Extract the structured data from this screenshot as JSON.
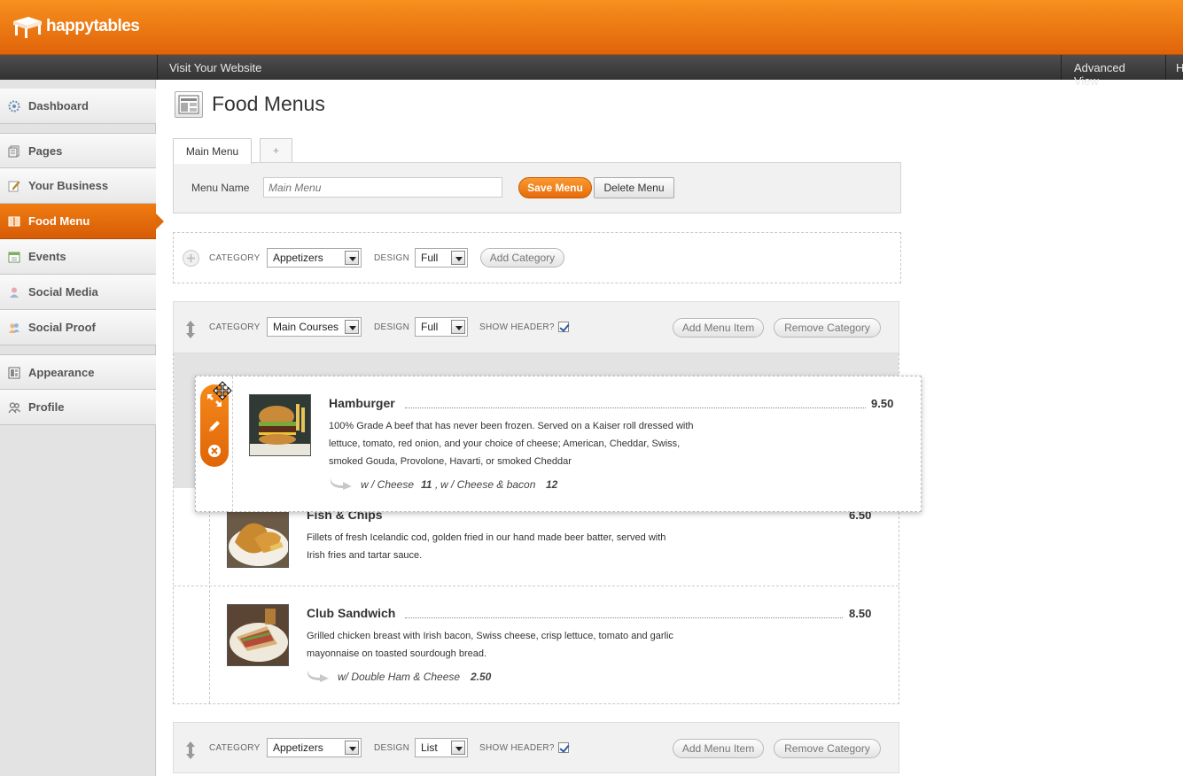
{
  "brand": {
    "name": "happytables"
  },
  "topnav": {
    "visit_site": "Visit Your Website",
    "advanced_view": "Advanced View",
    "help_partial": "H"
  },
  "sidebar": {
    "items": [
      {
        "label": "Dashboard",
        "icon": "dashboard-icon"
      },
      {
        "label": "Pages",
        "icon": "pages-icon"
      },
      {
        "label": "Your Business",
        "icon": "pencil-icon"
      },
      {
        "label": "Food Menu",
        "icon": "book-icon",
        "active": true
      },
      {
        "label": "Events",
        "icon": "calendar-icon"
      },
      {
        "label": "Social Media",
        "icon": "person-icon"
      },
      {
        "label": "Social Proof",
        "icon": "people-icon"
      },
      {
        "label": "Appearance",
        "icon": "layout-icon"
      },
      {
        "label": "Profile",
        "icon": "users-icon"
      }
    ]
  },
  "page": {
    "title": "Food Menus"
  },
  "tabs": {
    "main": "Main Menu",
    "add": "+"
  },
  "menu_form": {
    "name_label": "Menu Name",
    "name_placeholder": "Main Menu",
    "save_label": "Save Menu",
    "delete_label": "Delete Menu"
  },
  "new_category": {
    "category_label": "CATEGORY",
    "category_value": "Appetizers",
    "design_label": "DESIGN",
    "design_value": "Full",
    "add_label": "Add Category"
  },
  "categories": [
    {
      "category_label": "CATEGORY",
      "category_value": "Main Courses",
      "design_label": "DESIGN",
      "design_value": "Full",
      "show_header_label": "SHOW HEADER?",
      "show_header": true,
      "add_item_label": "Add Menu Item",
      "remove_label": "Remove Category",
      "items": [
        {
          "title": "Hamburger",
          "price": "9.50",
          "desc_lines": [
            "100% Grade A beef that has never been frozen. Served on a Kaiser roll dressed with",
            "lettuce, tomato, red onion, and your choice of cheese; American, Cheddar, Swiss,",
            "smoked Gouda, Provolone, Havarti, or smoked Cheddar"
          ],
          "addons": [
            {
              "label": "w / Cheese",
              "price": "11"
            },
            {
              "label": "w / Cheese & bacon",
              "price": "12"
            }
          ],
          "addon_sep": ","
        },
        {
          "title": "Fish & Chips",
          "price": "6.50",
          "desc_lines": [
            "Fillets of fresh Icelandic cod, golden fried in our hand made beer batter, served with",
            "Irish fries and tartar sauce."
          ]
        },
        {
          "title": "Club Sandwich",
          "price": "8.50",
          "desc_lines": [
            "Grilled chicken breast with Irish bacon, Swiss cheese, crisp lettuce, tomato and garlic",
            "mayonnaise on toasted sourdough bread."
          ],
          "addons": [
            {
              "label": "w/ Double Ham & Cheese",
              "price": "2.50"
            }
          ]
        }
      ]
    },
    {
      "category_label": "CATEGORY",
      "category_value": "Appetizers",
      "design_label": "DESIGN",
      "design_value": "List",
      "show_header_label": "SHOW HEADER?",
      "show_header": true,
      "add_item_label": "Add Menu Item",
      "remove_label": "Remove Category"
    }
  ],
  "colors": {
    "brand_orange": "#f07c12",
    "subnav_dark": "#3f3f3f",
    "sidebar_bg": "#e3e3e3"
  }
}
